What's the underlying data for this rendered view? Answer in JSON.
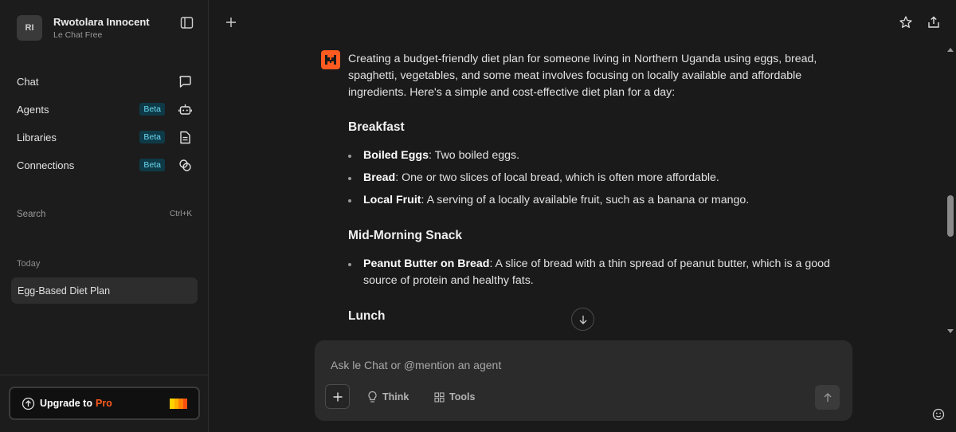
{
  "user": {
    "initials": "RI",
    "name": "Rwotolara Innocent",
    "plan": "Le Chat Free"
  },
  "sidebar": {
    "items": [
      {
        "label": "Chat",
        "badge": "",
        "icon": "chat-bubble-icon"
      },
      {
        "label": "Agents",
        "badge": "Beta",
        "icon": "robot-icon"
      },
      {
        "label": "Libraries",
        "badge": "Beta",
        "icon": "document-icon"
      },
      {
        "label": "Connections",
        "badge": "Beta",
        "icon": "connections-icon"
      }
    ],
    "search_label": "Search",
    "search_shortcut": "Ctrl+K",
    "section_today": "Today",
    "chats": [
      "Egg-Based Diet Plan"
    ],
    "upgrade_label": "Upgrade to",
    "upgrade_pro": "Pro"
  },
  "message": {
    "intro": "Creating a budget-friendly diet plan for someone living in Northern Uganda using eggs, bread, spaghetti, vegetables, and some meat involves focusing on locally available and affordable ingredients. Here's a simple and cost-effective diet plan for a day:",
    "breakfast_heading": "Breakfast",
    "breakfast_items": [
      {
        "bold": "Boiled Eggs",
        "text": ": Two boiled eggs."
      },
      {
        "bold": "Bread",
        "text": ": One or two slices of local bread, which is often more affordable."
      },
      {
        "bold": "Local Fruit",
        "text": ": A serving of a locally available fruit, such as a banana or mango."
      }
    ],
    "snack_heading": "Mid-Morning Snack",
    "snack_items": [
      {
        "bold": "Peanut Butter on Bread",
        "text": ": A slice of bread with a thin spread of peanut butter, which is a good source of protein and healthy fats."
      }
    ],
    "lunch_heading": "Lunch"
  },
  "composer": {
    "placeholder": "Ask le Chat or @mention an agent",
    "think_label": "Think",
    "tools_label": "Tools"
  },
  "colors": {
    "accent": "#ff5a1f",
    "beta_text": "#6ad7ef",
    "beta_bg": "#0e3a48"
  }
}
